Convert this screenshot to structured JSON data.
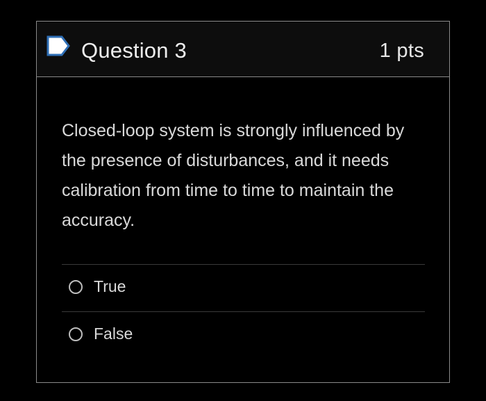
{
  "question": {
    "title": "Question 3",
    "points": "1 pts",
    "flag_icon": "bookmark-flag-icon",
    "text": "Closed-loop system is strongly influenced by the presence of disturbances, and it needs calibration from time to time to maintain the accuracy.",
    "answers": [
      {
        "label": "True",
        "selected": false
      },
      {
        "label": "False",
        "selected": false
      }
    ]
  },
  "colors": {
    "background": "#000000",
    "border": "#8a8a8a",
    "flag_icon": "#2f6fb6",
    "text": "#d9d9d9"
  }
}
